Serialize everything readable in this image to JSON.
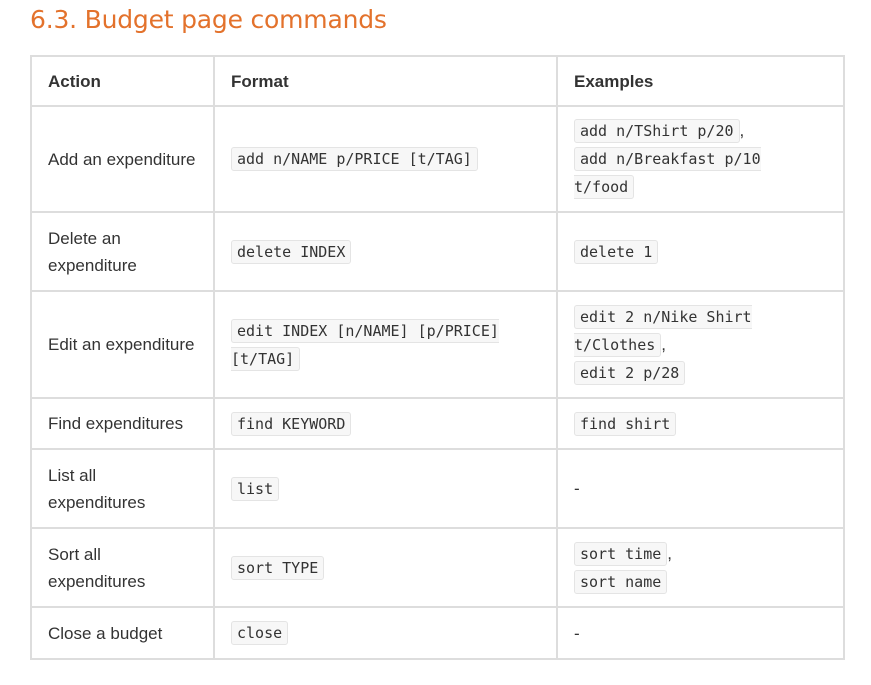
{
  "section": {
    "title": "6.3. Budget page commands"
  },
  "table": {
    "headers": [
      "Action",
      "Format",
      "Examples"
    ],
    "rows": [
      {
        "action": "Add an expenditure",
        "format": "add n/NAME p/PRICE [t/TAG]",
        "examples": [
          "add n/TShirt p/20",
          "add n/Breakfast p/10 t/food"
        ]
      },
      {
        "action": "Delete an expenditure",
        "format": "delete INDEX",
        "examples": [
          "delete 1"
        ]
      },
      {
        "action": "Edit an expenditure",
        "format": "edit INDEX [n/NAME] [p/PRICE] [t/TAG]",
        "examples": [
          "edit 2 n/Nike Shirt t/Clothes",
          "edit 2 p/28"
        ]
      },
      {
        "action": "Find expenditures",
        "format": "find KEYWORD",
        "examples": [
          "find shirt"
        ]
      },
      {
        "action": "List all expenditures",
        "format": "list",
        "examples": [],
        "empty": "-"
      },
      {
        "action": "Sort all expenditures",
        "format": "sort TYPE",
        "examples": [
          "sort time",
          "sort name"
        ]
      },
      {
        "action": "Close a budget",
        "format": "close",
        "examples": [],
        "empty": "-"
      }
    ],
    "separator": ","
  }
}
